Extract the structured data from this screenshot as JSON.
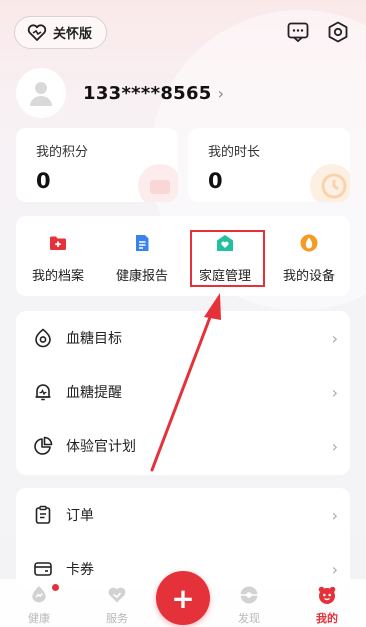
{
  "header": {
    "care_mode_label": "关怀版",
    "message_icon": "message-icon",
    "settings_icon": "settings-icon"
  },
  "profile": {
    "phone": "133****8565"
  },
  "stats": [
    {
      "label": "我的积分",
      "value": "0"
    },
    {
      "label": "我的时长",
      "value": "0"
    }
  ],
  "quick_actions": [
    {
      "label": "我的档案",
      "icon": "folder-icon",
      "color": "#e5323a"
    },
    {
      "label": "健康报告",
      "icon": "report-icon",
      "color": "#3a82f0"
    },
    {
      "label": "家庭管理",
      "icon": "family-home-icon",
      "color": "#22bfa0"
    },
    {
      "label": "我的设备",
      "icon": "device-icon",
      "color": "#f59a23"
    }
  ],
  "menu_group_1": [
    {
      "label": "血糖目标",
      "icon": "target-icon"
    },
    {
      "label": "血糖提醒",
      "icon": "alarm-icon"
    },
    {
      "label": "体验官计划",
      "icon": "pie-chart-icon"
    }
  ],
  "menu_group_2": [
    {
      "label": "订单",
      "icon": "order-icon"
    },
    {
      "label": "卡券",
      "icon": "wallet-icon"
    }
  ],
  "tabbar": {
    "tabs": [
      {
        "label": "健康",
        "icon": "health-icon"
      },
      {
        "label": "服务",
        "icon": "service-icon"
      },
      {
        "label": "发现",
        "icon": "discover-icon"
      },
      {
        "label": "我的",
        "icon": "mine-icon"
      }
    ],
    "fab_label": "+"
  },
  "colors": {
    "accent": "#e5323a",
    "highlight_box": "#e5323a"
  }
}
